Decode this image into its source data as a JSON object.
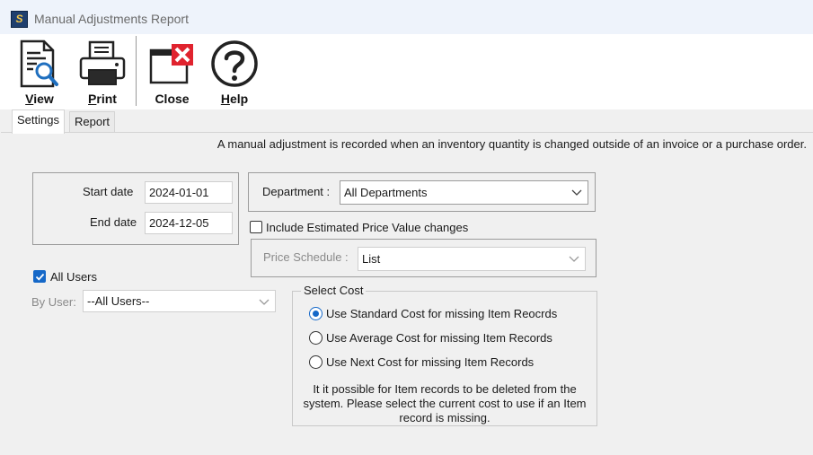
{
  "window": {
    "title": "Manual Adjustments Report",
    "app_icon_glyph": "S"
  },
  "toolbar": {
    "view": {
      "label_ul": "V",
      "label_rest": "iew",
      "icon": "document-search-icon"
    },
    "print": {
      "label_ul": "P",
      "label_rest": "rint",
      "icon": "printer-icon"
    },
    "close": {
      "label": "Close",
      "icon": "close-window-icon"
    },
    "help": {
      "label_ul": "H",
      "label_rest": "elp",
      "icon": "help-icon"
    }
  },
  "tabs": [
    {
      "label": "Settings",
      "active": true
    },
    {
      "label": "Report",
      "active": false
    }
  ],
  "settings": {
    "info": "A manual adjustment is recorded when an inventory quantity is changed outside of an invoice or a purchase order.",
    "start_date_label": "Start date",
    "start_date": "2024-01-01",
    "end_date_label": "End date",
    "end_date": "2024-12-05",
    "department_label": "Department :",
    "department": "All Departments",
    "include_estimated_label": "Include Estimated Price Value changes",
    "include_estimated": false,
    "price_schedule_label": "Price Schedule :",
    "price_schedule": "List",
    "all_users_label": "All Users",
    "all_users": true,
    "by_user_label": "By User:",
    "by_user": "--All Users--",
    "select_cost": {
      "title": "Select Cost",
      "options": [
        {
          "label": "Use Standard Cost for missing Item Reocrds",
          "selected": true
        },
        {
          "label": "Use Average Cost for missing Item Records",
          "selected": false
        },
        {
          "label": "Use Next Cost for missing Item Records",
          "selected": false
        }
      ],
      "note_line1": "It it possible for Item records to be deleted from the",
      "note_line2": "system. Please select the current cost to use if an Item",
      "note_line3": "record is missing."
    }
  },
  "colors": {
    "accent": "#1568c8",
    "close_red": "#e0232e",
    "titlebar": "#eef3fb"
  }
}
